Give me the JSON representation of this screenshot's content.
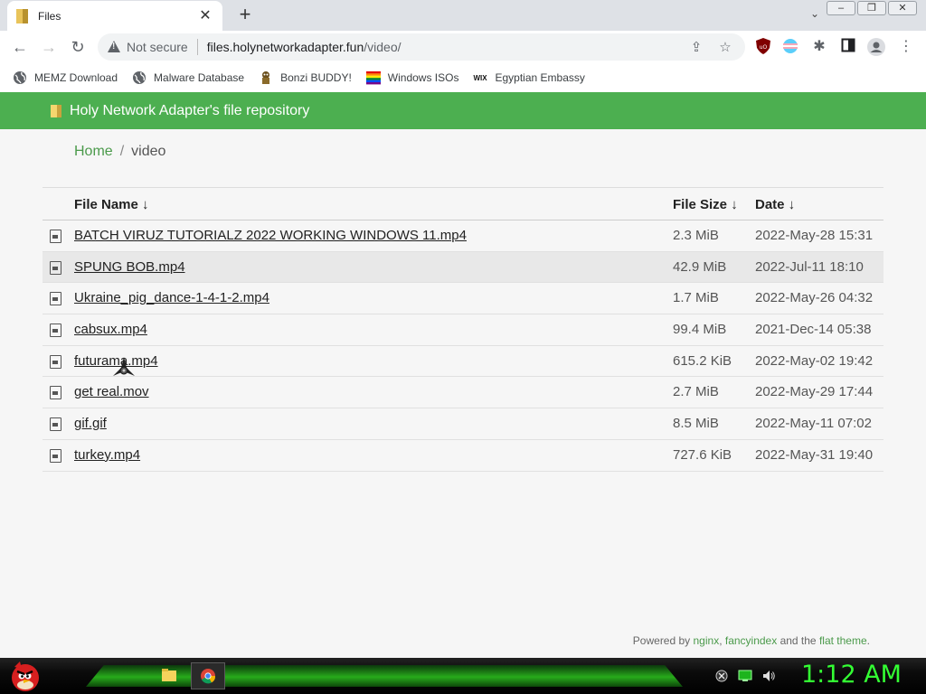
{
  "browser": {
    "tab_title": "Files",
    "omnibox_security": "Not secure",
    "url_host": "files.holynetworkadapter.fun",
    "url_path": "/video/",
    "bookmarks": [
      {
        "label": "MEMZ Download",
        "icon": "globe-icon"
      },
      {
        "label": "Malware Database",
        "icon": "globe-icon"
      },
      {
        "label": "Bonzi BUDDY!",
        "icon": "bonzi-icon"
      },
      {
        "label": "Windows ISOs",
        "icon": "rainbow-flag-icon"
      },
      {
        "label": "Egyptian Embassy",
        "icon": "wix-icon"
      }
    ],
    "wix_label": "WIX"
  },
  "site": {
    "title": "Holy Network Adapter's file repository",
    "header_color": "#4caf50",
    "breadcrumb": {
      "home": "Home",
      "separator": "/",
      "current": "video"
    }
  },
  "table": {
    "headers": {
      "name": "File Name ↓",
      "size": "File Size ↓",
      "date": "Date ↓"
    },
    "rows": [
      {
        "name": "BATCH VIRUZ TUTORIALZ 2022 WORKING WINDOWS 11.mp4",
        "size": "2.3 MiB",
        "date": "2022-May-28 15:31",
        "icon": "video-file-icon"
      },
      {
        "name": "SPUNG BOB.mp4",
        "size": "42.9 MiB",
        "date": "2022-Jul-11 18:10",
        "icon": "video-file-icon"
      },
      {
        "name": "Ukraine_pig_dance-1-4-1-2.mp4",
        "size": "1.7 MiB",
        "date": "2022-May-26 04:32",
        "icon": "video-file-icon"
      },
      {
        "name": "cabsux.mp4",
        "size": "99.4 MiB",
        "date": "2021-Dec-14 05:38",
        "icon": "video-file-icon"
      },
      {
        "name": "futurama.mp4",
        "size": "615.2 KiB",
        "date": "2022-May-02 19:42",
        "icon": "video-file-icon"
      },
      {
        "name": "get real.mov",
        "size": "2.7 MiB",
        "date": "2022-May-29 17:44",
        "icon": "video-file-icon"
      },
      {
        "name": "gif.gif",
        "size": "8.5 MiB",
        "date": "2022-May-11 07:02",
        "icon": "image-file-icon"
      },
      {
        "name": "turkey.mp4",
        "size": "727.6 KiB",
        "date": "2022-May-31 19:40",
        "icon": "video-file-icon"
      }
    ]
  },
  "footer": {
    "prefix": "Powered by ",
    "link1": "nginx",
    "comma": ", ",
    "link2": "fancyindex",
    "middle": " and the ",
    "link3": "flat theme",
    "suffix": "."
  },
  "taskbar": {
    "clock": "1:12 AM",
    "clock_color": "#33ff33"
  }
}
